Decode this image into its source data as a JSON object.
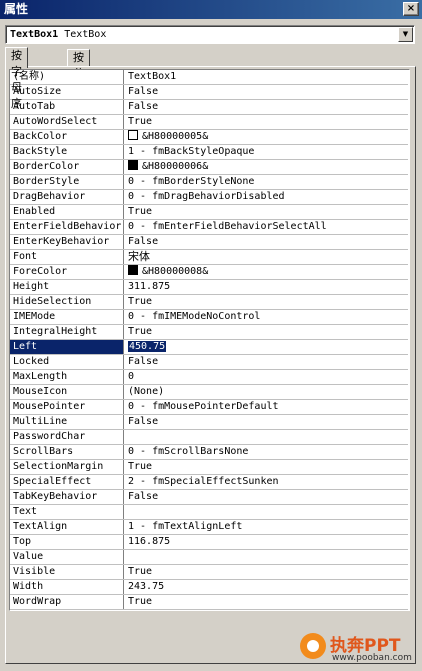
{
  "window": {
    "title": "属性",
    "close_label": "×"
  },
  "object_selector": {
    "name": "TextBox1",
    "type": "TextBox",
    "arrow": "▼"
  },
  "tabs": [
    {
      "label": "按字母序",
      "active": true
    },
    {
      "label": "按分类序",
      "active": false
    }
  ],
  "properties": [
    {
      "name": "(名称)",
      "value": "TextBox1"
    },
    {
      "name": "AutoSize",
      "value": "False"
    },
    {
      "name": "AutoTab",
      "value": "False"
    },
    {
      "name": "AutoWordSelect",
      "value": "True"
    },
    {
      "name": "BackColor",
      "value": "&H80000005&",
      "swatch": "#ffffff"
    },
    {
      "name": "BackStyle",
      "value": "1 - fmBackStyleOpaque"
    },
    {
      "name": "BorderColor",
      "value": "&H80000006&",
      "swatch": "#000000"
    },
    {
      "name": "BorderStyle",
      "value": "0 - fmBorderStyleNone"
    },
    {
      "name": "DragBehavior",
      "value": "0 - fmDragBehaviorDisabled"
    },
    {
      "name": "Enabled",
      "value": "True"
    },
    {
      "name": "EnterFieldBehavior",
      "value": "0 - fmEnterFieldBehaviorSelectAll"
    },
    {
      "name": "EnterKeyBehavior",
      "value": "False"
    },
    {
      "name": "Font",
      "value": "宋体",
      "cjk": true
    },
    {
      "name": "ForeColor",
      "value": "&H80000008&",
      "swatch": "#000000"
    },
    {
      "name": "Height",
      "value": "311.875"
    },
    {
      "name": "HideSelection",
      "value": "True"
    },
    {
      "name": "IMEMode",
      "value": "0 - fmIMEModeNoControl"
    },
    {
      "name": "IntegralHeight",
      "value": "True"
    },
    {
      "name": "Left",
      "value": "450.75",
      "selected": true
    },
    {
      "name": "Locked",
      "value": "False"
    },
    {
      "name": "MaxLength",
      "value": "0"
    },
    {
      "name": "MouseIcon",
      "value": "(None)"
    },
    {
      "name": "MousePointer",
      "value": "0 - fmMousePointerDefault"
    },
    {
      "name": "MultiLine",
      "value": "False"
    },
    {
      "name": "PasswordChar",
      "value": ""
    },
    {
      "name": "ScrollBars",
      "value": "0 - fmScrollBarsNone"
    },
    {
      "name": "SelectionMargin",
      "value": "True"
    },
    {
      "name": "SpecialEffect",
      "value": "2 - fmSpecialEffectSunken"
    },
    {
      "name": "TabKeyBehavior",
      "value": "False"
    },
    {
      "name": "Text",
      "value": ""
    },
    {
      "name": "TextAlign",
      "value": "1 - fmTextAlignLeft"
    },
    {
      "name": "Top",
      "value": "116.875"
    },
    {
      "name": "Value",
      "value": ""
    },
    {
      "name": "Visible",
      "value": "True"
    },
    {
      "name": "Width",
      "value": "243.75"
    },
    {
      "name": "WordWrap",
      "value": "True"
    }
  ],
  "watermark": {
    "title": "执奔PPT",
    "url": "www.pooban.com"
  },
  "colors": {
    "title_bar": "#0a246a",
    "selection": "#0a246a",
    "face": "#d4d0c8",
    "watermark_orange": "#f28b1c"
  }
}
